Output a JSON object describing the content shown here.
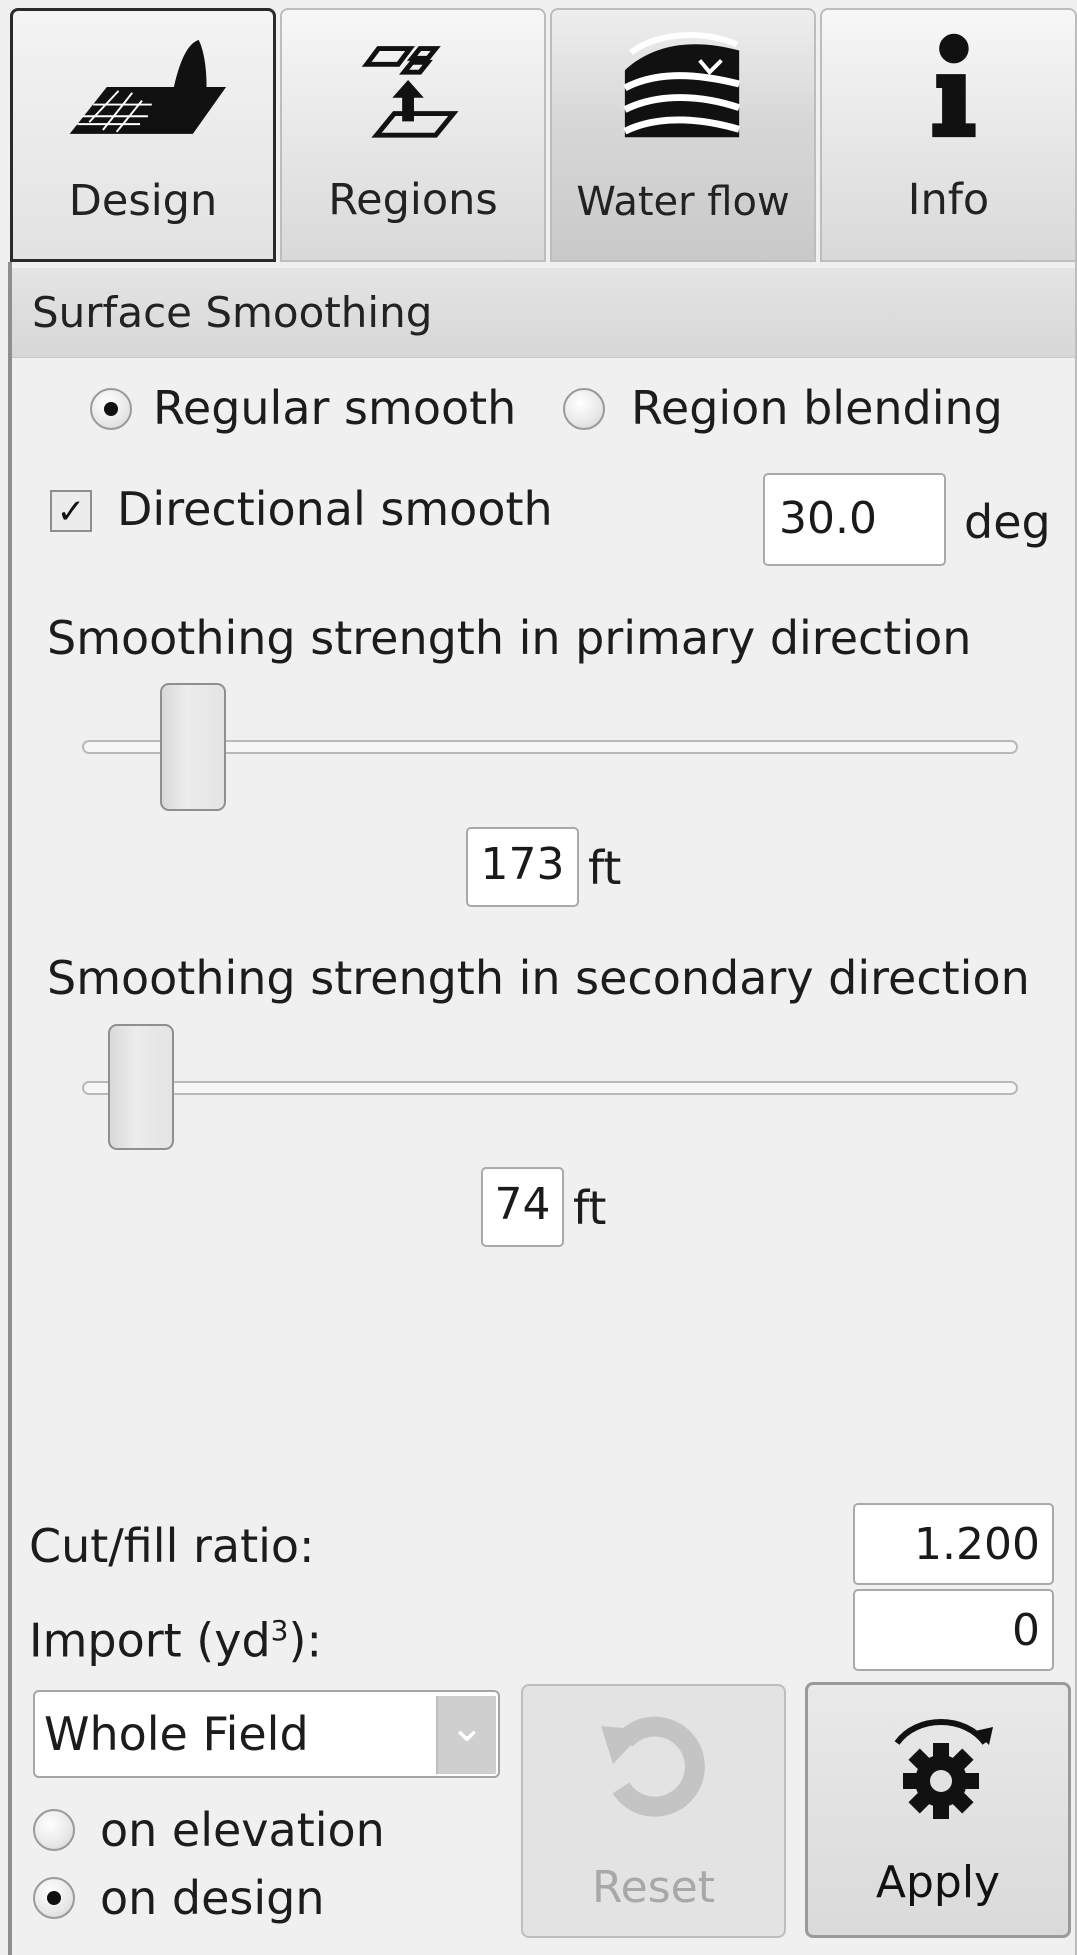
{
  "tabs": [
    {
      "label": "Design",
      "icon": "terrain-design-icon",
      "active": true
    },
    {
      "label": "Regions",
      "icon": "regions-icon",
      "active": false
    },
    {
      "label": "Water flow",
      "icon": "water-flow-icon",
      "active": false
    },
    {
      "label": "Info",
      "icon": "info-icon",
      "active": false
    }
  ],
  "section": {
    "title": "Surface Smoothing"
  },
  "smooth_mode": {
    "options": [
      "Regular smooth",
      "Region blending"
    ],
    "selected": "Regular smooth"
  },
  "directional": {
    "label": "Directional smooth",
    "checked": true,
    "checkmark": "✓",
    "angle_value": "30.0",
    "angle_unit": "deg"
  },
  "primary": {
    "label": "Smoothing strength in primary direction",
    "value": "173",
    "unit": "ft",
    "slider_fraction": 0.09
  },
  "secondary": {
    "label": "Smoothing strength in secondary direction",
    "value": "74",
    "unit": "ft",
    "slider_fraction": 0.03
  },
  "cutfill": {
    "label": "Cut/fill ratio:",
    "value": "1.200"
  },
  "import": {
    "label_prefix": "Import (yd",
    "label_sup": "3",
    "label_suffix": "):",
    "value": "0"
  },
  "scope": {
    "selected": "Whole Field",
    "chevron": "⌄"
  },
  "apply_mode": {
    "options": [
      "on elevation",
      "on design"
    ],
    "selected": "on design"
  },
  "buttons": {
    "reset": {
      "label": "Reset",
      "icon": "undo-icon",
      "enabled": false
    },
    "apply": {
      "label": "Apply",
      "icon": "gear-refresh-icon",
      "enabled": true
    }
  },
  "colors": {
    "background": "#f0f0f0",
    "accent_dark": "#111111",
    "disabled_text": "#a8a8a8"
  }
}
